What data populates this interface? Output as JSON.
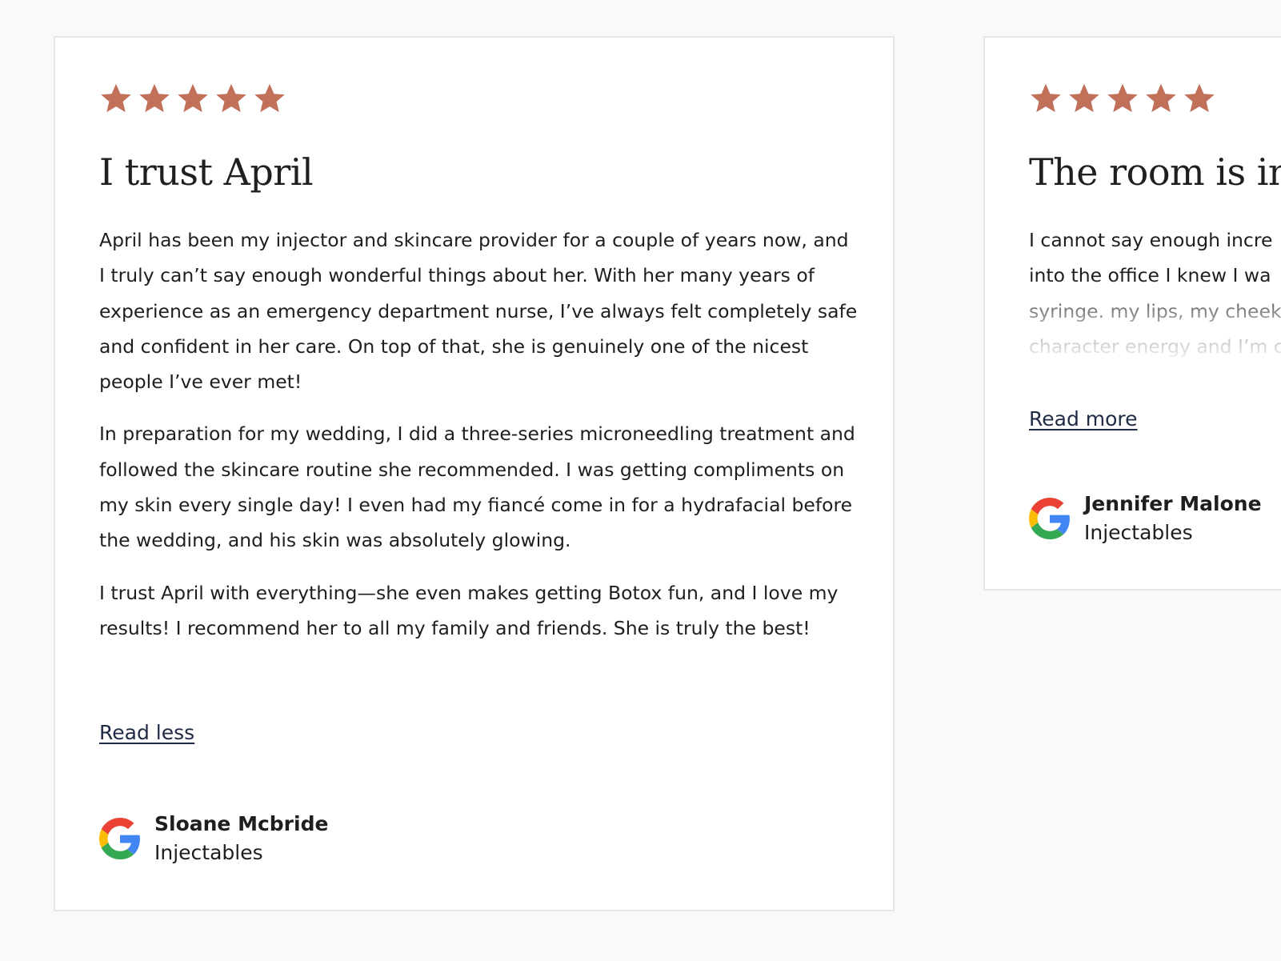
{
  "colors": {
    "page_background": "#f9f9f9",
    "card_background": "#ffffff",
    "star": "#c1705a",
    "link": "#1f2a44",
    "text": "#1e1e1e"
  },
  "reviews": [
    {
      "rating": 5,
      "title": "I trust April",
      "paragraphs": [
        "April has been my injector and skincare provider for a couple of years now, and I truly can’t say enough wonderful things about her. With her many years of experience as an emergency department nurse, I’ve always felt completely safe and confident in her care. On top of that, she is genuinely one of the nicest people I’ve ever met!",
        "In preparation for my wedding, I did a three-series microneedling treatment and followed the skincare routine she recommended. I was getting compliments on my skin every single day! I even had my fiancé come in for a hydrafacial before the wedding, and his skin was absolutely glowing.",
        "I trust April with everything—she even makes getting Botox fun, and I love my results! I recommend her to all my family and friends. She is truly the best!"
      ],
      "toggle_label": "Read less",
      "source_icon": "google-icon",
      "author": "Sloane Mcbride",
      "category": "Injectables"
    },
    {
      "rating": 5,
      "title": "The room is imm",
      "lines": [
        "I cannot say enough incre",
        "into the office I knew I wa",
        "syringe. my lips, my cheek",
        "character energy and I’m c"
      ],
      "toggle_label": "Read more",
      "source_icon": "google-icon",
      "author": "Jennifer Malone",
      "category": "Injectables"
    }
  ]
}
